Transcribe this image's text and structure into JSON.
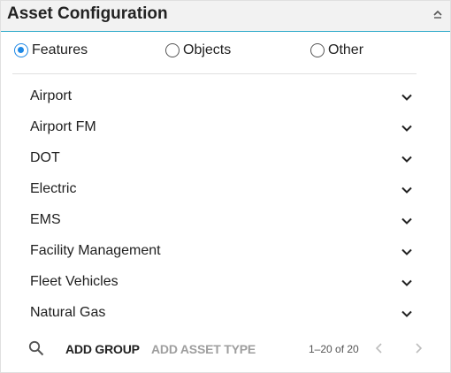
{
  "header": {
    "title": "Asset Configuration",
    "collapse_icon": "collapse-up-icon"
  },
  "radio": {
    "options": [
      {
        "label": "Features",
        "selected": true
      },
      {
        "label": "Objects",
        "selected": false
      },
      {
        "label": "Other",
        "selected": false
      }
    ]
  },
  "groups": [
    {
      "label": "Airport"
    },
    {
      "label": "Airport FM"
    },
    {
      "label": "DOT"
    },
    {
      "label": "Electric"
    },
    {
      "label": "EMS"
    },
    {
      "label": "Facility Management"
    },
    {
      "label": "Fleet Vehicles"
    },
    {
      "label": "Natural Gas"
    }
  ],
  "footer": {
    "add_group": "ADD GROUP",
    "add_asset_type": "ADD ASSET TYPE",
    "pagination": "1–20 of 20"
  },
  "colors": {
    "accent": "#1e88e5",
    "header_rule": "#29a8c8",
    "disabled_text": "#9e9e9e"
  }
}
